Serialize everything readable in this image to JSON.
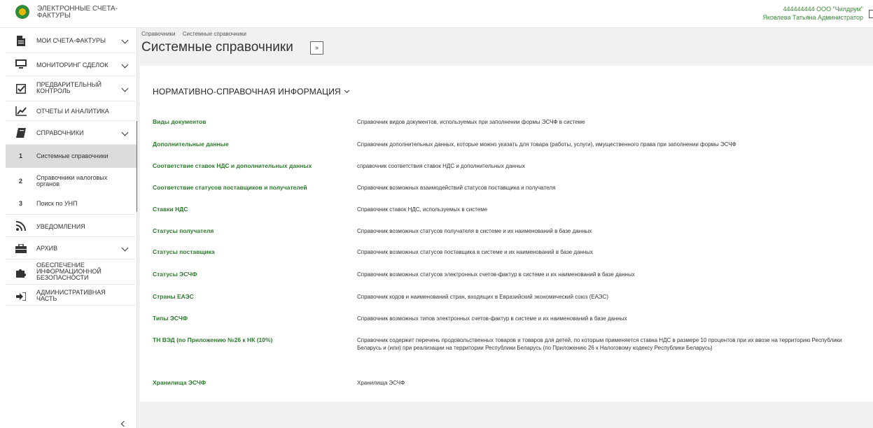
{
  "header": {
    "app_title": "ЭЛЕКТРОННЫЕ СЧЕТА-ФАКТУРЫ",
    "org": "444444444 ООО \"Чилдрум\"",
    "user": "Яковлева Татьяна Администратор"
  },
  "sidebar": {
    "items": [
      {
        "label": "МОИ СЧЕТА-ФАКТУРЫ",
        "icon": "document-icon"
      },
      {
        "label": "МОНИТОРИНГ СДЕЛОК",
        "icon": "monitor-icon"
      },
      {
        "label": "ПРЕДВАРИТЕЛЬНЫЙ КОНТРОЛЬ",
        "icon": "checkbox-icon"
      },
      {
        "label": "ОТЧЕТЫ И АНАЛИТИКА",
        "icon": "chart-line-icon"
      },
      {
        "label": "СПРАВОЧНИКИ",
        "icon": "book-icon"
      },
      {
        "label": "УВЕДОМЛЕНИЯ",
        "icon": "rss-icon"
      },
      {
        "label": "АРХИВ",
        "icon": "briefcase-icon"
      },
      {
        "label": "ОБЕСПЕЧЕНИЕ ИНФОРМАЦИОННОЙ БЕЗОПАСНОСТИ",
        "icon": "puzzle-icon"
      },
      {
        "label": "АДМИНИСТРАТИВНАЯ ЧАСТЬ",
        "icon": "sign-in-icon"
      }
    ],
    "sub_items": [
      {
        "num": "1",
        "label": "Системные справочники"
      },
      {
        "num": "2",
        "label": "Справочники налоговых органов"
      },
      {
        "num": "3",
        "label": "Поиск по УНП"
      }
    ]
  },
  "breadcrumb": [
    "Справочники",
    "Системные справочники"
  ],
  "page_title": "Системные справочники",
  "toggle_symbol": "»",
  "section_title": "НОРМАТИВНО-СПРАВОЧНАЯ ИНФОРМАЦИЯ",
  "rows": [
    {
      "name": "Виды документов",
      "desc": "Справочник видов документов, используемых при заполнении формы ЭСЧФ в системе"
    },
    {
      "name": "Дополнительные данные",
      "desc": "Справочник дополнительных данных, которые можно указать для товара (работы, услуги), имущественного права при заполнении формы ЭСЧФ"
    },
    {
      "name": "Соответствие ставок НДС и дополнительных данных",
      "desc": "справочник соответствия ставок НДС и дополнительных данных"
    },
    {
      "name": "Соответствие статусов поставщиков и получателей",
      "desc": "Справочник возможных взаимодействий статусов поставщика и получателя"
    },
    {
      "name": "Ставки НДС",
      "desc": "Справочник ставок НДС, используемых в системе"
    },
    {
      "name": "Статусы получателя",
      "desc": "Справочник возможных статусов получателя в системе и их наименований в базе данных"
    },
    {
      "name": "Статусы поставщика",
      "desc": "Справочник возможных статусов поставщика в системе и их наименований в базе данных"
    },
    {
      "name": "Статусы ЭСЧФ",
      "desc": "Справочник возможных статусов электронных счетов-фактур в системе и их наименований в базе данных"
    },
    {
      "name": "Страны ЕАЭС",
      "desc": "Справочник кодов и наименований стран, входящих в Евразийский экономический союз (ЕАЭС)"
    },
    {
      "name": "Типы ЭСЧФ",
      "desc": "Справочник возможных типов электронных счетов-фактур в системе и их наименований в базе данных"
    },
    {
      "name": "ТН ВЭД (по Приложению №26 к НК (10%)",
      "desc": "Справочник содержит перечень продовольственных товаров и товаров для детей, по которым применяется ставка НДС в размере 10 процентов при их ввозе на территорию Республики Беларусь и (или) при реализации на территории Республики Беларусь (по Приложению 26 к Налоговому кодексу Республики Беларусь)"
    },
    {
      "name": "Хранилища ЭСЧФ",
      "desc": "Хранилища ЭСЧФ"
    }
  ],
  "colors": {
    "accent": "#2f8f2f",
    "link": "#2a7a2a",
    "background": "#f1f1f1"
  }
}
